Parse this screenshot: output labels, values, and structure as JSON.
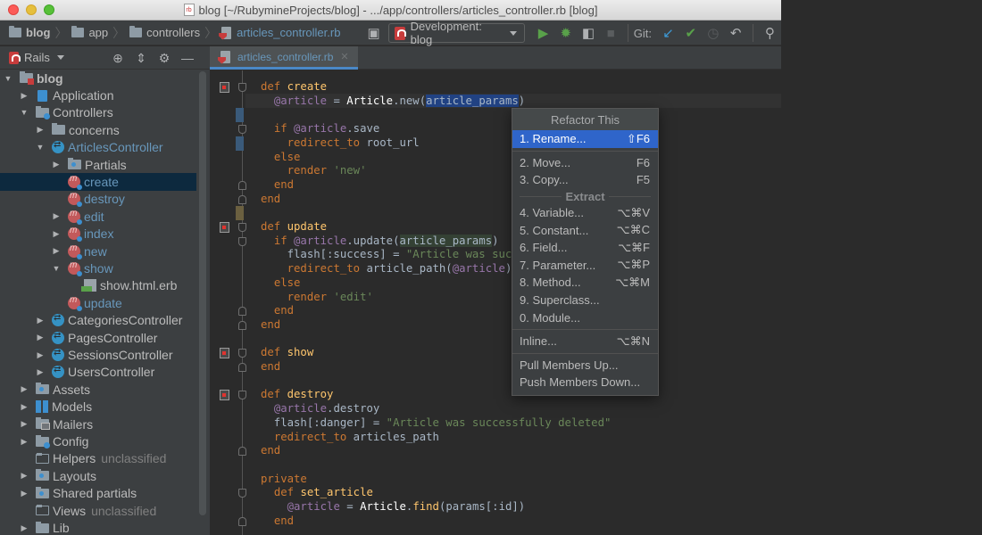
{
  "window": {
    "title": "blog [~/RubymineProjects/blog] - .../app/controllers/articles_controller.rb [blog]"
  },
  "breadcrumbs": [
    "blog",
    "app",
    "controllers",
    "articles_controller.rb"
  ],
  "toolbar": {
    "run_config": "Development: blog",
    "git_label": "Git:"
  },
  "project_panel": {
    "view_label": "Rails"
  },
  "editor_tab": {
    "label": "articles_controller.rb"
  },
  "tree": [
    {
      "label": "blog",
      "level": 0,
      "arrow": "down",
      "icon": "folder-red",
      "style": "bold"
    },
    {
      "label": "Application",
      "level": 1,
      "arrow": "right",
      "icon": "app"
    },
    {
      "label": "Controllers",
      "level": 1,
      "arrow": "down",
      "icon": "folder-gear"
    },
    {
      "label": "concerns",
      "level": 2,
      "arrow": "right",
      "icon": "folder"
    },
    {
      "label": "ArticlesController",
      "level": 2,
      "arrow": "down",
      "icon": "controller",
      "style": "active"
    },
    {
      "label": "Partials",
      "level": 3,
      "arrow": "right",
      "icon": "folder-blue"
    },
    {
      "label": "create",
      "level": 3,
      "arrow": "none",
      "icon": "method",
      "style": "method",
      "selected": true
    },
    {
      "label": "destroy",
      "level": 3,
      "arrow": "none",
      "icon": "method",
      "style": "method"
    },
    {
      "label": "edit",
      "level": 3,
      "arrow": "right",
      "icon": "method",
      "style": "method"
    },
    {
      "label": "index",
      "level": 3,
      "arrow": "right",
      "icon": "method",
      "style": "method"
    },
    {
      "label": "new",
      "level": 3,
      "arrow": "right",
      "icon": "method",
      "style": "method"
    },
    {
      "label": "show",
      "level": 3,
      "arrow": "down",
      "icon": "method",
      "style": "method"
    },
    {
      "label": "show.html.erb",
      "level": 4,
      "arrow": "none",
      "icon": "erb"
    },
    {
      "label": "update",
      "level": 3,
      "arrow": "none",
      "icon": "method",
      "style": "method"
    },
    {
      "label": "CategoriesController",
      "level": 2,
      "arrow": "right",
      "icon": "controller"
    },
    {
      "label": "PagesController",
      "level": 2,
      "arrow": "right",
      "icon": "controller"
    },
    {
      "label": "SessionsController",
      "level": 2,
      "arrow": "right",
      "icon": "controller"
    },
    {
      "label": "UsersController",
      "level": 2,
      "arrow": "right",
      "icon": "controller"
    },
    {
      "label": "Assets",
      "level": 1,
      "arrow": "right",
      "icon": "folder-blue"
    },
    {
      "label": "Models",
      "level": 1,
      "arrow": "right",
      "icon": "models"
    },
    {
      "label": "Mailers",
      "level": 1,
      "arrow": "right",
      "icon": "folder-mail"
    },
    {
      "label": "Config",
      "level": 1,
      "arrow": "right",
      "icon": "folder-gear"
    },
    {
      "label": "Helpers",
      "level": 1,
      "arrow": "none",
      "icon": "folder-plain",
      "suffix": "unclassified"
    },
    {
      "label": "Layouts",
      "level": 1,
      "arrow": "right",
      "icon": "folder-blue"
    },
    {
      "label": "Shared partials",
      "level": 1,
      "arrow": "right",
      "icon": "folder-blue"
    },
    {
      "label": "Views",
      "level": 1,
      "arrow": "none",
      "icon": "folder-plain",
      "suffix": "unclassified"
    },
    {
      "label": "Lib",
      "level": 1,
      "arrow": "right",
      "icon": "folder"
    }
  ],
  "code": [
    {
      "line": 0,
      "tokens": [
        [
          "kw",
          "def "
        ],
        [
          "fn",
          "create"
        ]
      ]
    },
    {
      "line": 1,
      "tokens": [
        [
          "",
          "  "
        ],
        [
          "ivar",
          "@article"
        ],
        [
          "",
          " = "
        ],
        [
          "cls",
          "Article"
        ],
        [
          "",
          "."
        ],
        [
          "",
          "new("
        ],
        [
          "sel",
          "article_params"
        ],
        [
          "",
          ")"
        ]
      ]
    },
    {
      "line": 2,
      "tokens": []
    },
    {
      "line": 3,
      "tokens": [
        [
          "",
          "  "
        ],
        [
          "kw",
          "if "
        ],
        [
          "ivar",
          "@article"
        ],
        [
          "",
          ".save"
        ]
      ]
    },
    {
      "line": 4,
      "tokens": [
        [
          "",
          "    "
        ],
        [
          "kw",
          "redirect_to "
        ],
        [
          "",
          "root_url"
        ]
      ]
    },
    {
      "line": 5,
      "tokens": [
        [
          "",
          "  "
        ],
        [
          "kw",
          "else"
        ]
      ]
    },
    {
      "line": 6,
      "tokens": [
        [
          "",
          "    "
        ],
        [
          "kw",
          "render "
        ],
        [
          "str",
          "'new'"
        ]
      ]
    },
    {
      "line": 7,
      "tokens": [
        [
          "",
          "  "
        ],
        [
          "kw",
          "end"
        ]
      ]
    },
    {
      "line": 8,
      "tokens": [
        [
          "kw",
          "end"
        ]
      ]
    },
    {
      "line": 9,
      "tokens": []
    },
    {
      "line": 10,
      "tokens": [
        [
          "kw",
          "def "
        ],
        [
          "fn",
          "update"
        ]
      ]
    },
    {
      "line": 11,
      "tokens": [
        [
          "",
          "  "
        ],
        [
          "kw",
          "if "
        ],
        [
          "ivar",
          "@article"
        ],
        [
          "",
          ".update("
        ],
        [
          "hl",
          "article_params"
        ],
        [
          "",
          ")"
        ]
      ]
    },
    {
      "line": 12,
      "tokens": [
        [
          "",
          "    flash[:success] = "
        ],
        [
          "str",
          "\"Article was successfully updated\""
        ]
      ]
    },
    {
      "line": 13,
      "tokens": [
        [
          "",
          "    "
        ],
        [
          "kw",
          "redirect_to "
        ],
        [
          "",
          "article_path("
        ],
        [
          "ivar",
          "@article"
        ],
        [
          "",
          ")"
        ]
      ]
    },
    {
      "line": 14,
      "tokens": [
        [
          "",
          "  "
        ],
        [
          "kw",
          "else"
        ]
      ]
    },
    {
      "line": 15,
      "tokens": [
        [
          "",
          "    "
        ],
        [
          "kw",
          "render "
        ],
        [
          "str",
          "'edit'"
        ]
      ]
    },
    {
      "line": 16,
      "tokens": [
        [
          "",
          "  "
        ],
        [
          "kw",
          "end"
        ]
      ]
    },
    {
      "line": 17,
      "tokens": [
        [
          "kw",
          "end"
        ]
      ]
    },
    {
      "line": 18,
      "tokens": []
    },
    {
      "line": 19,
      "tokens": [
        [
          "kw",
          "def "
        ],
        [
          "fn",
          "show"
        ]
      ]
    },
    {
      "line": 20,
      "tokens": [
        [
          "kw",
          "end"
        ]
      ]
    },
    {
      "line": 21,
      "tokens": []
    },
    {
      "line": 22,
      "tokens": [
        [
          "kw",
          "def "
        ],
        [
          "fn",
          "destroy"
        ]
      ]
    },
    {
      "line": 23,
      "tokens": [
        [
          "",
          "  "
        ],
        [
          "ivar",
          "@article"
        ],
        [
          "",
          ".destroy"
        ]
      ]
    },
    {
      "line": 24,
      "tokens": [
        [
          "",
          "  flash[:danger] = "
        ],
        [
          "str",
          "\"Article was successfully deleted\""
        ]
      ]
    },
    {
      "line": 25,
      "tokens": [
        [
          "",
          "  "
        ],
        [
          "kw",
          "redirect_to "
        ],
        [
          "",
          "articles_path"
        ]
      ]
    },
    {
      "line": 26,
      "tokens": [
        [
          "kw",
          "end"
        ]
      ]
    },
    {
      "line": 27,
      "tokens": []
    },
    {
      "line": 28,
      "tokens": [
        [
          "kw",
          "private"
        ]
      ]
    },
    {
      "line": 29,
      "tokens": [
        [
          "",
          "  "
        ],
        [
          "kw",
          "def "
        ],
        [
          "fn",
          "set_article"
        ]
      ]
    },
    {
      "line": 30,
      "tokens": [
        [
          "",
          "    "
        ],
        [
          "ivar",
          "@article"
        ],
        [
          "",
          " = "
        ],
        [
          "cls",
          "Article"
        ],
        [
          "",
          "."
        ],
        [
          "meth",
          "find"
        ],
        [
          "",
          "(params[:id])"
        ]
      ]
    },
    {
      "line": 31,
      "tokens": [
        [
          "",
          "  "
        ],
        [
          "kw",
          "end"
        ]
      ]
    }
  ],
  "refactor_popup": {
    "title": "Refactor This",
    "items": [
      {
        "type": "item",
        "label": "1. Rename...",
        "shortcut": "⇧F6",
        "selected": true
      },
      {
        "type": "sep"
      },
      {
        "type": "item",
        "label": "2. Move...",
        "shortcut": "F6"
      },
      {
        "type": "item",
        "label": "3. Copy...",
        "shortcut": "F5"
      },
      {
        "type": "group",
        "label": "Extract"
      },
      {
        "type": "item",
        "label": "4. Variable...",
        "shortcut": "⌥⌘V"
      },
      {
        "type": "item",
        "label": "5. Constant...",
        "shortcut": "⌥⌘C"
      },
      {
        "type": "item",
        "label": "6. Field...",
        "shortcut": "⌥⌘F"
      },
      {
        "type": "item",
        "label": "7. Parameter...",
        "shortcut": "⌥⌘P"
      },
      {
        "type": "item",
        "label": "8. Method...",
        "shortcut": "⌥⌘M"
      },
      {
        "type": "item",
        "label": "9. Superclass...",
        "shortcut": ""
      },
      {
        "type": "item",
        "label": "0. Module...",
        "shortcut": ""
      },
      {
        "type": "sep"
      },
      {
        "type": "item",
        "label": "Inline...",
        "shortcut": "⌥⌘N"
      },
      {
        "type": "sep"
      },
      {
        "type": "item",
        "label": "Pull Members Up...",
        "shortcut": ""
      },
      {
        "type": "item",
        "label": "Push Members Down...",
        "shortcut": ""
      }
    ]
  },
  "colors": {
    "accent": "#2f65ca",
    "keyword": "#cc7832",
    "function": "#ffc66d",
    "instance_var": "#9876aa",
    "string": "#6a8759",
    "link": "#6897bb"
  }
}
